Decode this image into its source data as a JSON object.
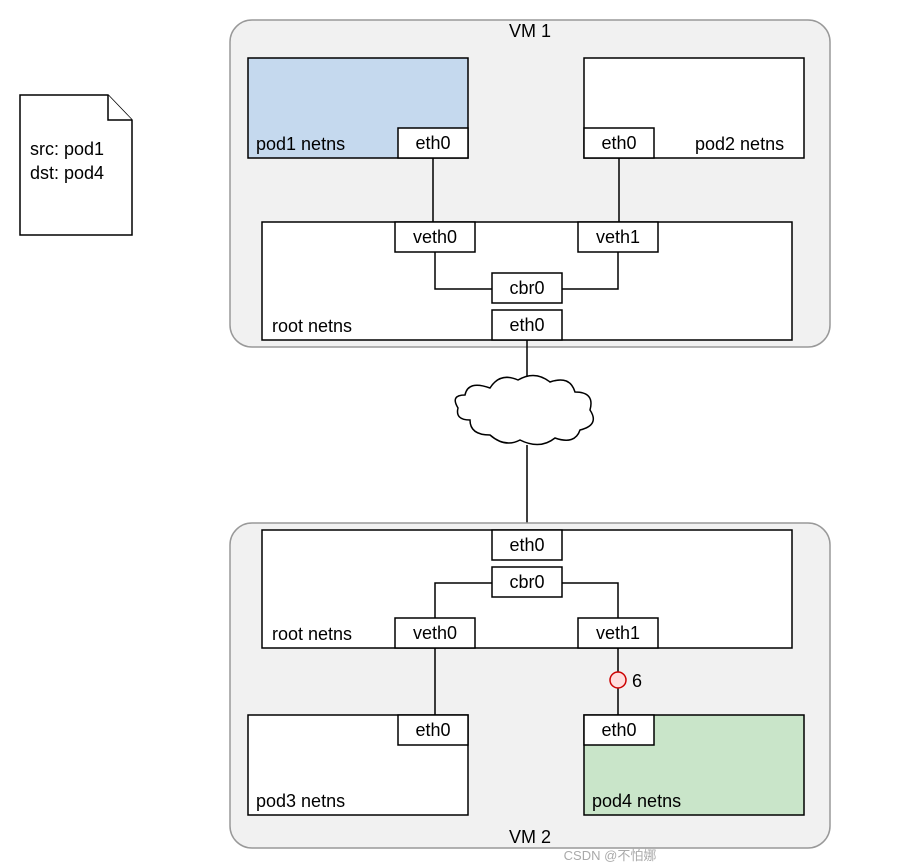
{
  "vm1": {
    "title": "VM 1",
    "pod1": {
      "label": "pod1 netns",
      "eth": "eth0"
    },
    "pod2": {
      "label": "pod2 netns",
      "eth": "eth0"
    },
    "root": {
      "label": "root netns",
      "veth0": "veth0",
      "veth1": "veth1",
      "cbr0": "cbr0",
      "eth0": "eth0"
    }
  },
  "vm2": {
    "title": "VM 2",
    "pod3": {
      "label": "pod3 netns",
      "eth": "eth0"
    },
    "pod4": {
      "label": "pod4 netns",
      "eth": "eth0"
    },
    "root": {
      "label": "root netns",
      "veth0": "veth0",
      "veth1": "veth1",
      "cbr0": "cbr0",
      "eth0": "eth0"
    },
    "marker": "6"
  },
  "packet": {
    "src": "src: pod1",
    "dst": "dst: pod4"
  },
  "watermark": "CSDN @不怕娜"
}
